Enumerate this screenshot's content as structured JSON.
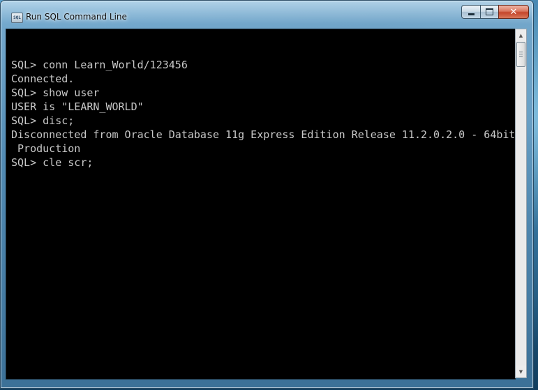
{
  "window": {
    "title": "Run SQL Command Line",
    "icon": "sql-console-icon",
    "icon_text": "SQL"
  },
  "controls": {
    "minimize": "minimize-icon",
    "maximize": "maximize-icon",
    "close": "close-icon",
    "close_glyph": "✕"
  },
  "console": {
    "background": "#000000",
    "text_color": "#c8c8c8",
    "lines": [
      "",
      "SQL> conn Learn_World/123456",
      "Connected.",
      "SQL> show user",
      "USER is \"LEARN_WORLD\"",
      "SQL> disc;",
      "Disconnected from Oracle Database 11g Express Edition Release 11.2.0.2.0 - 64bit",
      " Production",
      "SQL> cle scr;"
    ]
  },
  "scrollbar": {
    "up_glyph": "▲",
    "down_glyph": "▼"
  }
}
